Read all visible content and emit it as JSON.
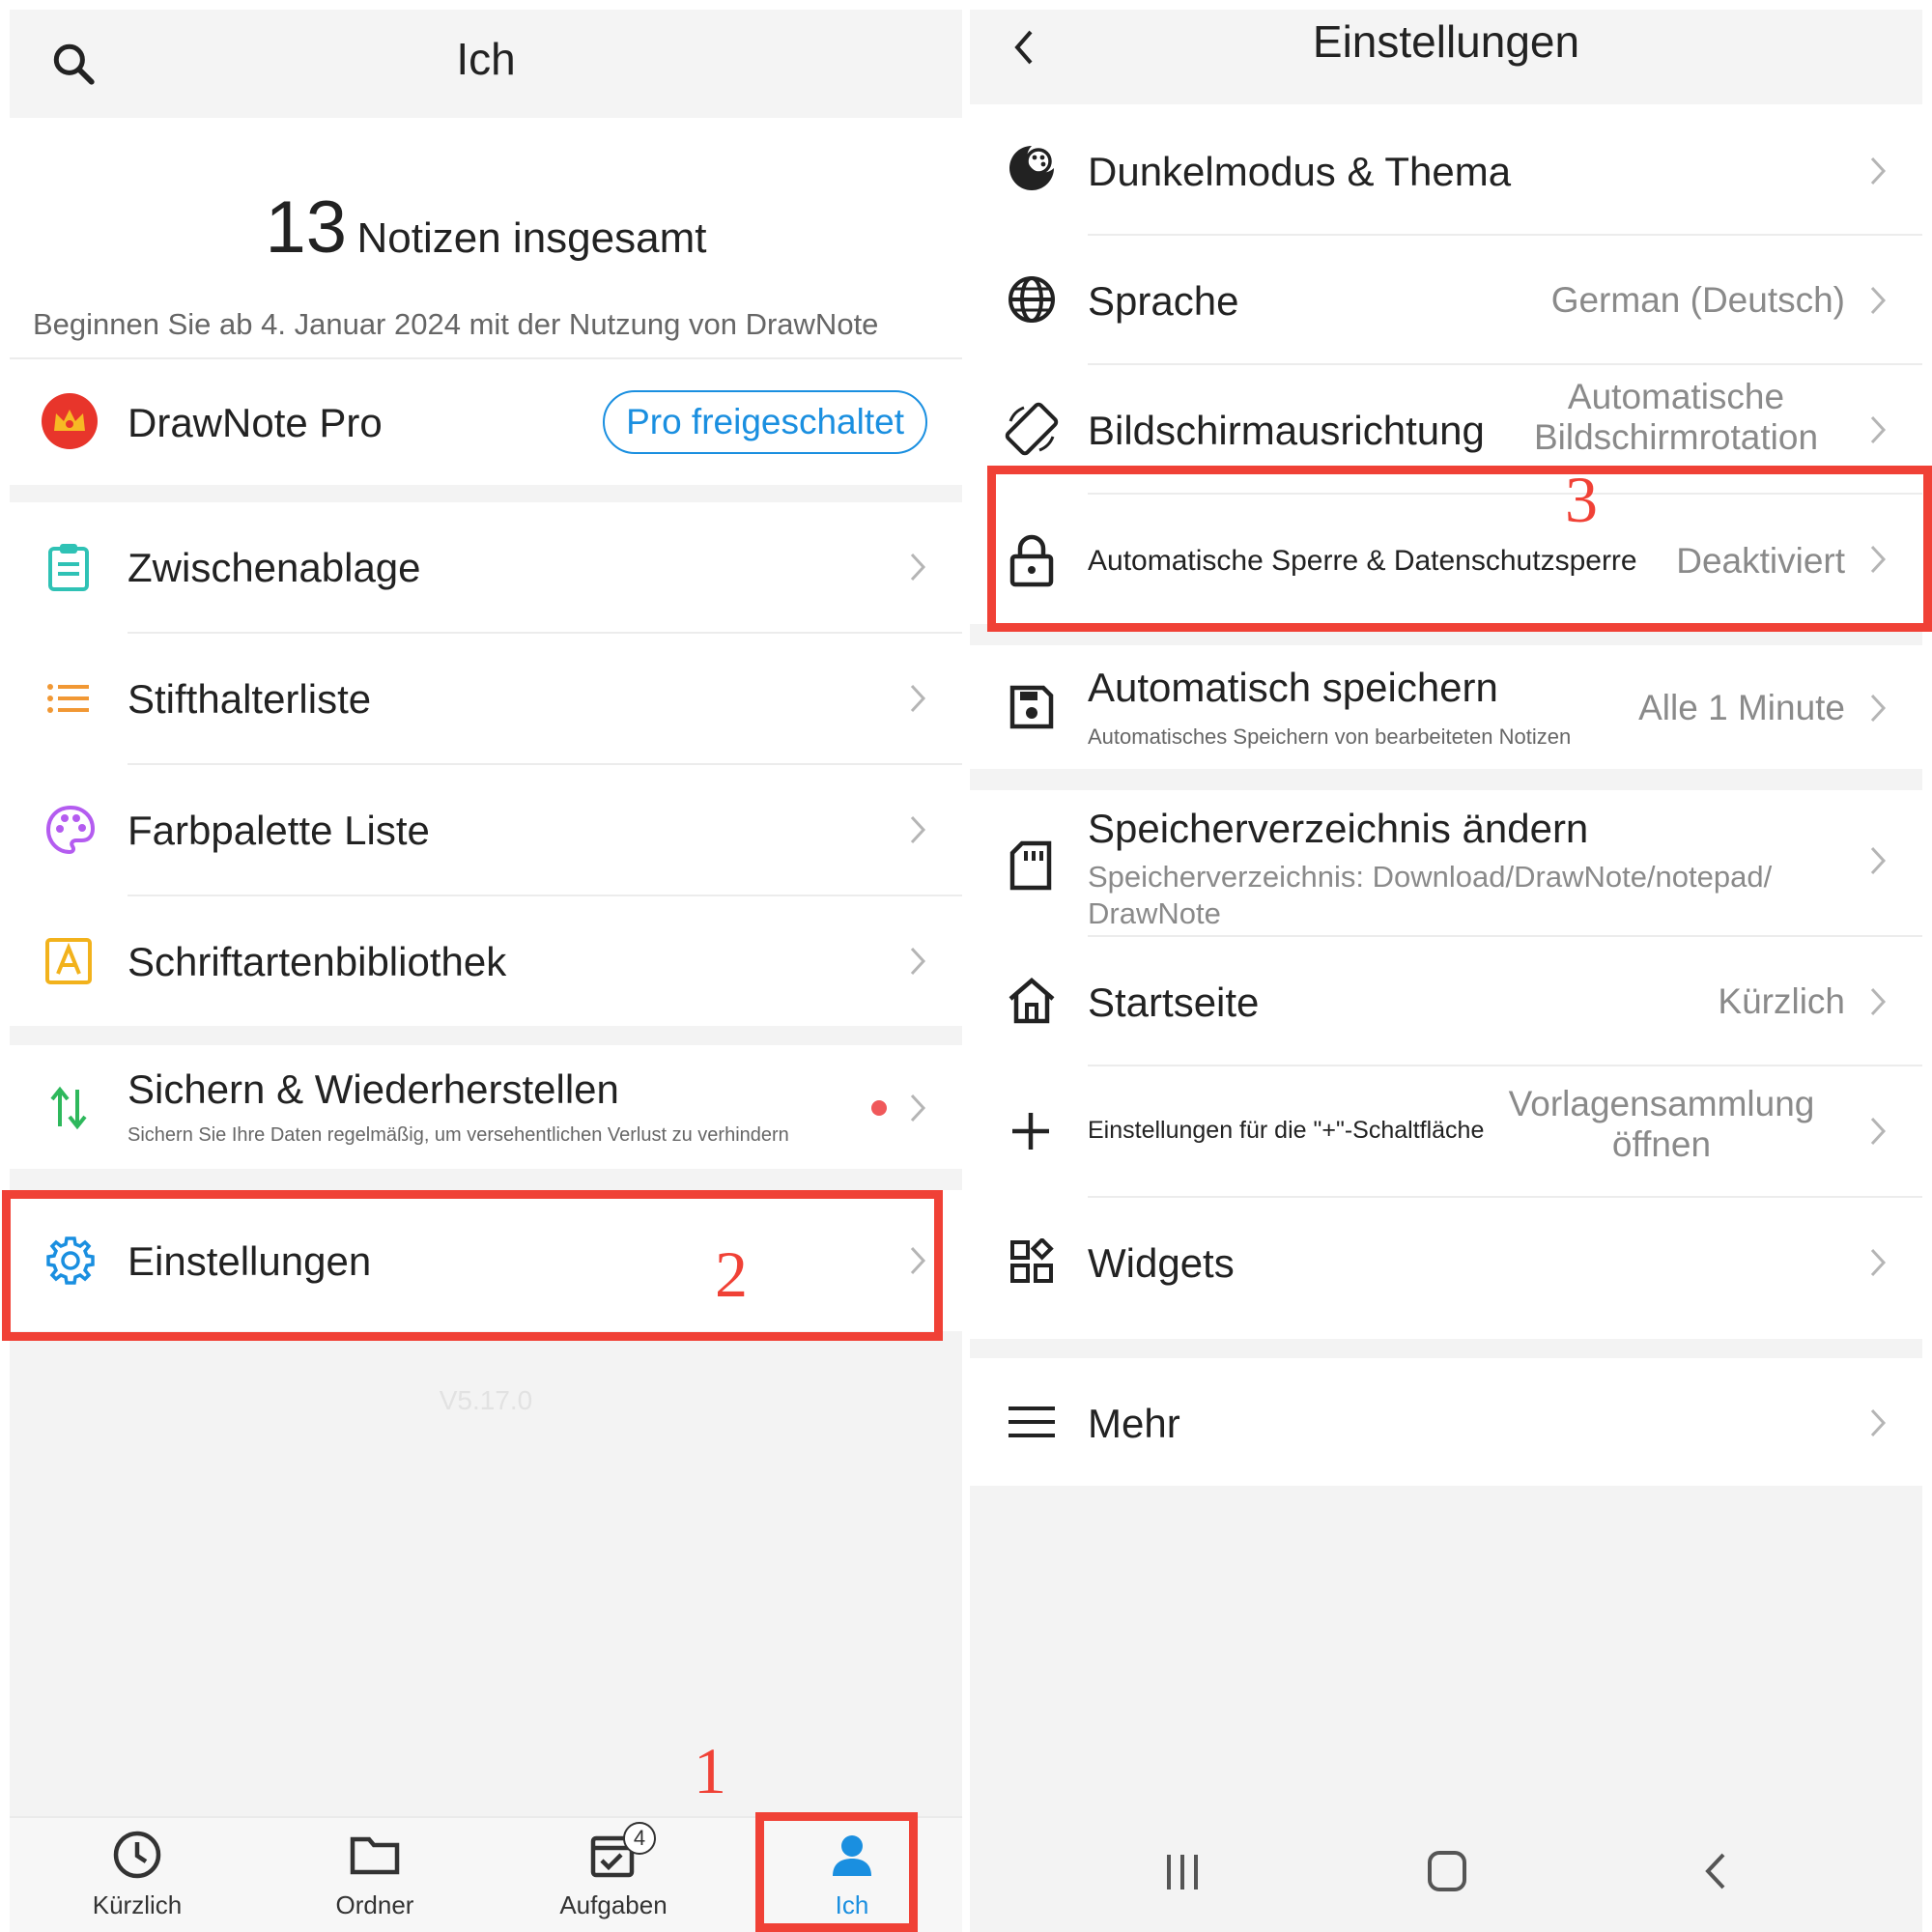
{
  "left": {
    "header": {
      "title": "Ich",
      "search_icon": "search-icon"
    },
    "summary": {
      "count": "13",
      "count_label": "Notizen insgesamt",
      "since": "Beginnen Sie ab 4. Januar 2024 mit der Nutzung von DrawNote"
    },
    "pro": {
      "label": "DrawNote Pro",
      "badge": "Pro freigeschaltet",
      "icon": "crown-icon"
    },
    "items": [
      {
        "label": "Zwischenablage",
        "icon": "clipboard-icon"
      },
      {
        "label": "Stifthalterliste",
        "icon": "list-icon"
      },
      {
        "label": "Farbpalette Liste",
        "icon": "palette-icon"
      },
      {
        "label": "Schriftartenbibliothek",
        "icon": "font-icon"
      }
    ],
    "backup": {
      "label": "Sichern & Wiederherstellen",
      "sub": "Sichern Sie Ihre Daten regelmäßig, um versehentlichen Verlust zu verhindern",
      "icon": "sync-arrows-icon"
    },
    "settings": {
      "label": "Einstellungen",
      "icon": "gear-icon"
    },
    "version": "V5.17.0",
    "nav": [
      {
        "label": "Kürzlich",
        "icon": "clock-icon"
      },
      {
        "label": "Ordner",
        "icon": "folder-icon"
      },
      {
        "label": "Aufgaben",
        "icon": "task-calendar-icon",
        "badge": "4"
      },
      {
        "label": "Ich",
        "icon": "person-icon",
        "active": true
      }
    ],
    "annotations": {
      "n1": "1",
      "n2": "2"
    }
  },
  "right": {
    "header": {
      "title": "Einstellungen",
      "back_icon": "chevron-left-icon"
    },
    "items": [
      {
        "label": "Dunkelmodus & Thema",
        "icon": "theme-icon"
      },
      {
        "label": "Sprache",
        "value": "German (Deutsch)",
        "icon": "globe-icon"
      },
      {
        "label": "Bildschirmausrichtung",
        "value_line1": "Automatische",
        "value_line2": "Bildschirmrotation",
        "icon": "screen-rotation-icon"
      },
      {
        "label": "Automatische Sperre & Datenschutzsperre",
        "value": "Deaktiviert",
        "icon": "lock-icon"
      },
      {
        "label": "Automatisch speichern",
        "sub": "Automatisches Speichern von bearbeiteten Notizen",
        "value": "Alle 1 Minute",
        "icon": "save-icon"
      },
      {
        "label": "Speicherverzeichnis ändern",
        "sub_line1": "Speicherverzeichnis: Download/DrawNote/notepad/",
        "sub_line2": "DrawNote",
        "icon": "sd-card-icon"
      },
      {
        "label": "Startseite",
        "value": "Kürzlich",
        "icon": "home-icon"
      },
      {
        "label": "Einstellungen für die \"+\"-Schaltfläche",
        "value_line1": "Vorlagensammlung",
        "value_line2": "öffnen",
        "icon": "plus-icon"
      },
      {
        "label": "Widgets",
        "icon": "widgets-icon"
      },
      {
        "label": "Mehr",
        "icon": "menu-icon"
      }
    ],
    "annotations": {
      "n3": "3"
    }
  },
  "colors": {
    "accent": "#1a8fe0",
    "annotation": "#f04136",
    "dot": "#f0585a"
  }
}
